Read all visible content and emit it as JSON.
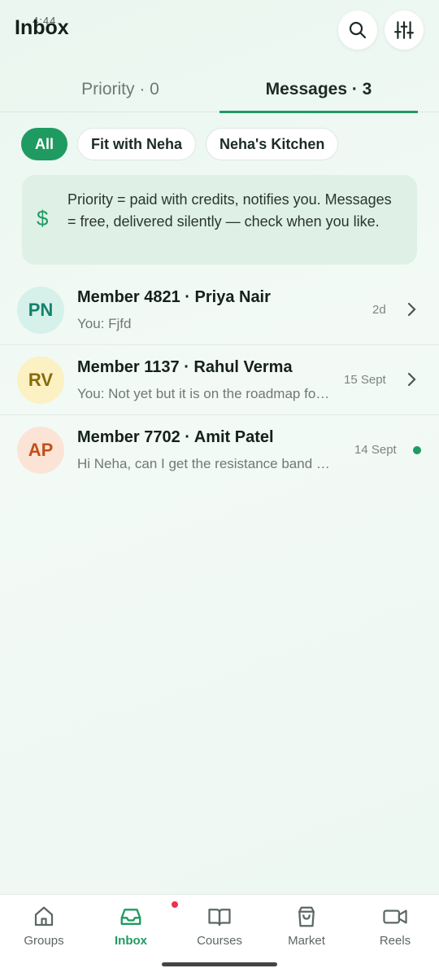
{
  "header": {
    "title": "Inbox",
    "status_time": "4:44"
  },
  "tabs": [
    {
      "label": "Priority · 0"
    },
    {
      "label": "Messages · 3"
    }
  ],
  "chips": [
    {
      "label": "All"
    },
    {
      "label": "Fit with Neha"
    },
    {
      "label": "Neha's Kitchen"
    }
  ],
  "info": {
    "icon": "$",
    "text": "Priority = paid with credits, notifies you. Messages = free, delivered silently — check when you like."
  },
  "messages": [
    {
      "initials": "PN",
      "name": "Member 4821 · Priya Nair",
      "preview": "You: Fjfd",
      "time": "2d"
    },
    {
      "initials": "RV",
      "name": "Member 1137 · Rahul Verma",
      "preview": "You: Not yet but it is on the roadmap for the next release",
      "time": "15 Sept"
    },
    {
      "initials": "AP",
      "name": "Member 7702 · Amit Patel",
      "preview": "Hi Neha, can I get the resistance band workout plan?",
      "time": "14 Sept"
    }
  ],
  "nav": [
    {
      "label": "Groups"
    },
    {
      "label": "Inbox"
    },
    {
      "label": "Courses"
    },
    {
      "label": "Market"
    },
    {
      "label": "Reels"
    }
  ],
  "colors": {
    "accent": "#1f9b62",
    "badge": "#e8344a"
  }
}
